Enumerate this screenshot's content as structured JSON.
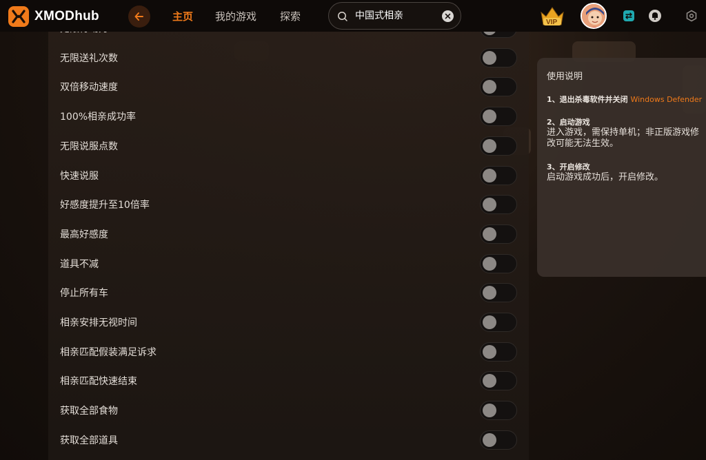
{
  "app": {
    "name": "XMODhub"
  },
  "nav": {
    "home": "主页",
    "my_games": "我的游戏",
    "explore": "探索"
  },
  "search": {
    "value": "中国式相亲"
  },
  "vip": {
    "label": "VIP"
  },
  "colors": {
    "accent": "#f07a1a",
    "background": "#120d0a",
    "toggle_off": "#141110"
  },
  "cheats": [
    {
      "label": "无限行动力",
      "enabled": false
    },
    {
      "label": "无限送礼次数",
      "enabled": false
    },
    {
      "label": "双倍移动速度",
      "enabled": false
    },
    {
      "label": "100%相亲成功率",
      "enabled": false
    },
    {
      "label": "无限说服点数",
      "enabled": false
    },
    {
      "label": "快速说服",
      "enabled": false
    },
    {
      "label": "好感度提升至10倍率",
      "enabled": false
    },
    {
      "label": "最高好感度",
      "enabled": false
    },
    {
      "label": "道具不减",
      "enabled": false
    },
    {
      "label": "停止所有车",
      "enabled": false
    },
    {
      "label": "相亲安排无视时间",
      "enabled": false
    },
    {
      "label": "相亲匹配假装满足诉求",
      "enabled": false
    },
    {
      "label": "相亲匹配快速结束",
      "enabled": false
    },
    {
      "label": "获取全部食物",
      "enabled": false
    },
    {
      "label": "获取全部道具",
      "enabled": false
    }
  ],
  "instructions": {
    "title": "使用说明",
    "step1_head": "1、退出杀毒软件并关闭",
    "step1_accent": "Windows Defender",
    "step2_head": "2、启动游戏",
    "step2_body": "进入游戏，需保持单机；非正版游戏修改可能无法生效。",
    "step3_head": "3、开启修改",
    "step3_body": "启动游戏成功后，开启修改。"
  },
  "icons": {
    "logo": "xmod-logo-icon",
    "back": "arrow-left-icon",
    "search": "search-icon",
    "clear": "close-icon",
    "vip": "vip-crown-icon",
    "avatar": "user-avatar",
    "switch": "switch-icon",
    "notification": "bell-icon",
    "settings": "gear-icon"
  }
}
